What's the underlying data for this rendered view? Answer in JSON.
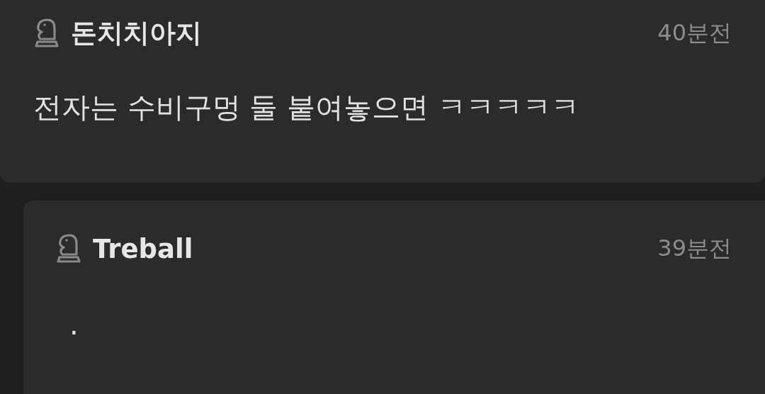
{
  "comments": [
    {
      "author": "돈치치아지",
      "time": "40분전",
      "text": "전자는 수비구멍 둘 붙여놓으면 ㅋㅋㅋㅋㅋ",
      "reply": false
    },
    {
      "author": "Treball",
      "time": "39분전",
      "text": ".",
      "reply": true
    }
  ]
}
